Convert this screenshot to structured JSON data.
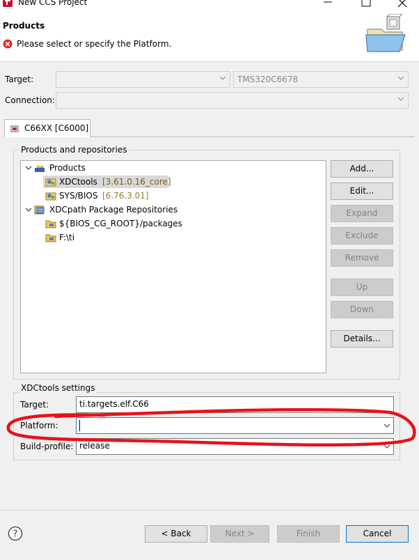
{
  "window": {
    "title": "New CCS Project"
  },
  "header": {
    "heading": "Products",
    "message": "Please select or specify the Platform."
  },
  "target_row": {
    "label": "Target:",
    "device_value": "TMS320C6678"
  },
  "connection_row": {
    "label": "Connection:"
  },
  "tab": {
    "label": "C66XX [C6000]"
  },
  "products_group": {
    "title": "Products and repositories",
    "tree": [
      {
        "label": "Products",
        "version": ""
      },
      {
        "label": "XDCtools",
        "version": "[3.61.0.16_core]"
      },
      {
        "label": "SYS/BIOS",
        "version": "[6.76.3.01]"
      },
      {
        "label": "XDCpath Package Repositories",
        "version": ""
      },
      {
        "label": "${BIOS_CG_ROOT}/packages",
        "version": ""
      },
      {
        "label": "F:\\ti",
        "version": ""
      }
    ],
    "buttons": {
      "add": "Add...",
      "edit": "Edit...",
      "expand": "Expand",
      "exclude": "Exclude",
      "remove": "Remove",
      "up": "Up",
      "down": "Down",
      "details": "Details..."
    }
  },
  "xdc_settings": {
    "title": "XDCtools settings",
    "target_label": "Target:",
    "target_value": "ti.targets.elf.C66",
    "platform_label": "Platform:",
    "platform_value": "",
    "build_profile_label": "Build-profile:",
    "build_profile_value": "release"
  },
  "footer": {
    "back": "< Back",
    "next": "Next >",
    "finish": "Finish",
    "cancel": "Cancel"
  },
  "colors": {
    "annotation_red": "#e8121a",
    "selection_bg": "#d9d9d9",
    "version_gray": "#8a6a2a"
  },
  "icons": [
    "app-logo-icon",
    "minimize-icon",
    "maximize-icon",
    "close-icon",
    "error-icon",
    "wizard-folder-graphic",
    "help-icon"
  ]
}
